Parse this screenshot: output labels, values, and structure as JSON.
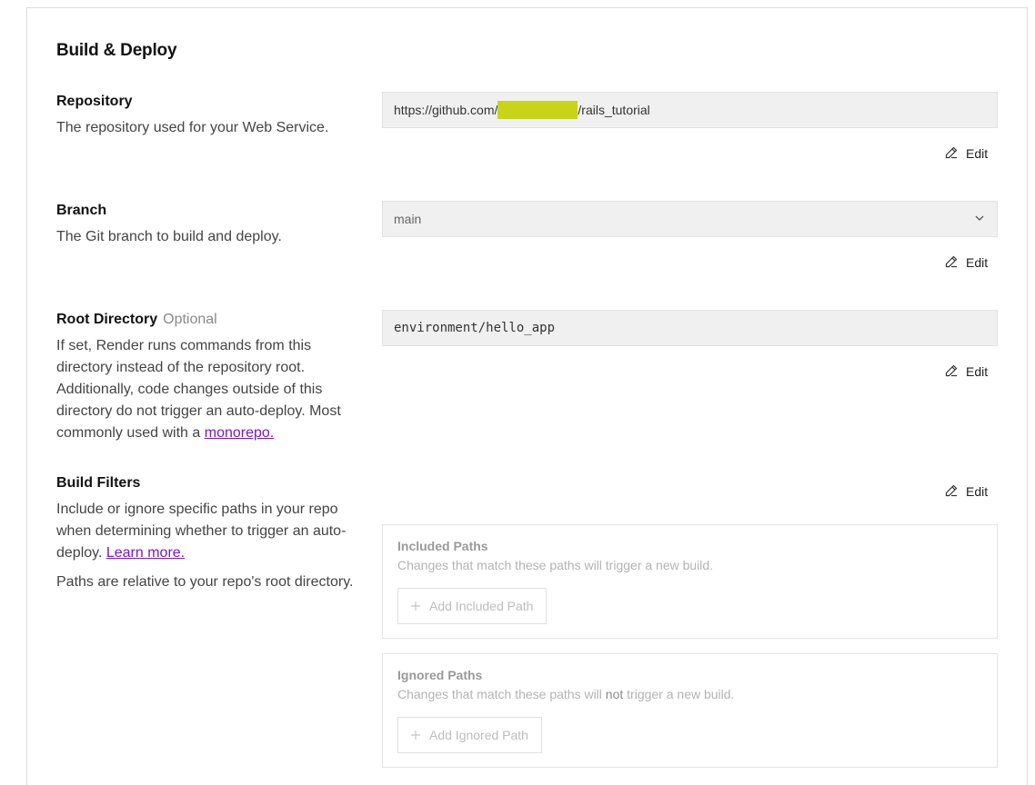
{
  "section": {
    "title": "Build & Deploy"
  },
  "repository": {
    "label": "Repository",
    "description": "The repository used for your Web Service.",
    "value_prefix": "https://github.com/",
    "value_suffix": "/rails_tutorial",
    "edit_label": "Edit"
  },
  "branch": {
    "label": "Branch",
    "description": "The Git branch to build and deploy.",
    "value": "main",
    "edit_label": "Edit"
  },
  "root_directory": {
    "label": "Root Directory",
    "optional_label": "Optional",
    "description": "If set, Render runs commands from this directory instead of the repository root. Additionally, code changes outside of this directory do not trigger an auto-deploy. Most commonly used with a",
    "link_text": "monorepo.",
    "value": "environment/hello_app",
    "edit_label": "Edit"
  },
  "build_filters": {
    "label": "Build Filters",
    "description": "Include or ignore specific paths in your repo when determining whether to trigger an auto-deploy.",
    "link_text": "Learn more.",
    "note": "Paths are relative to your repo's root directory.",
    "edit_label": "Edit",
    "included": {
      "title": "Included Paths",
      "subtitle": "Changes that match these paths will trigger a new build.",
      "add_label": "Add Included Path"
    },
    "ignored": {
      "title": "Ignored Paths",
      "subtitle_before": "Changes that match these paths will",
      "subtitle_em": "not",
      "subtitle_after": "trigger a new build.",
      "add_label": "Add Ignored Path"
    }
  }
}
